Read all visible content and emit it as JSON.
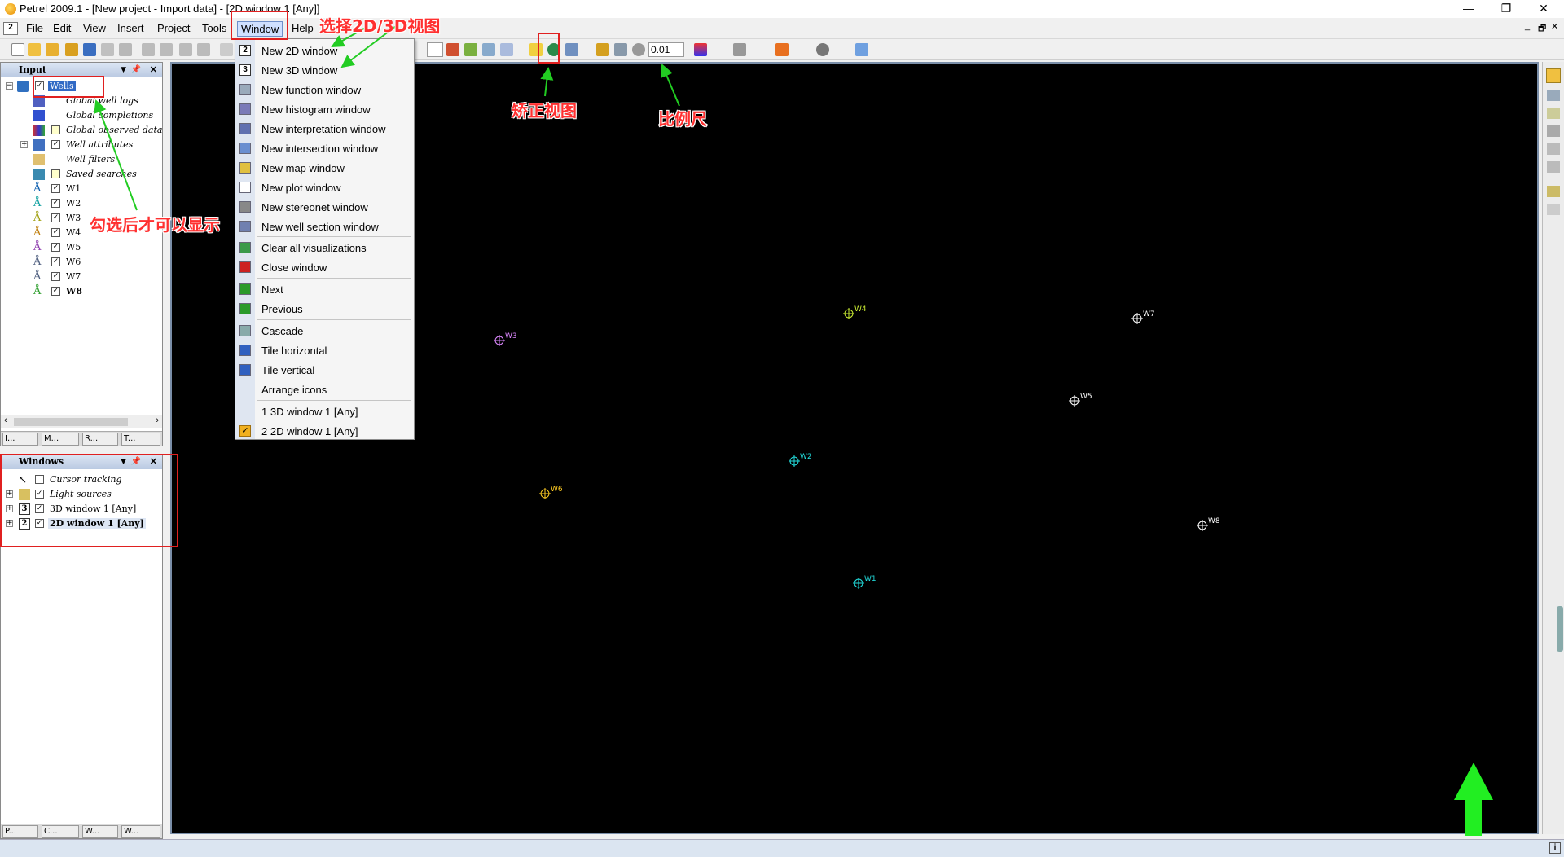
{
  "window": {
    "title": "Petrel 2009.1 - [New project - Import data] - [2D window 1 [Any]]",
    "minimize": "—",
    "restore": "❐",
    "close": "✕",
    "mdi_minimize": "_",
    "mdi_restore": "🗗",
    "mdi_close": "✕"
  },
  "menubar": {
    "doc_icon": "2",
    "items": [
      "File",
      "Edit",
      "View",
      "Insert",
      "Project",
      "Tools",
      "Window",
      "Help"
    ]
  },
  "toolbar": {
    "scale_value": "0.01"
  },
  "input_panel": {
    "title": "Input",
    "tree": [
      {
        "label": "Wells",
        "checked": true
      },
      {
        "label": "Global well logs"
      },
      {
        "label": "Global completions"
      },
      {
        "label": "Global observed data"
      },
      {
        "label": "Well attributes",
        "checked": true
      },
      {
        "label": "Well filters"
      },
      {
        "label": "Saved searches"
      },
      {
        "label": "W1",
        "checked": true
      },
      {
        "label": "W2",
        "checked": true
      },
      {
        "label": "W3",
        "checked": true
      },
      {
        "label": "W4",
        "checked": true
      },
      {
        "label": "W5",
        "checked": true
      },
      {
        "label": "W6",
        "checked": true
      },
      {
        "label": "W7",
        "checked": true
      },
      {
        "label": "W8",
        "checked": true
      }
    ],
    "tabs": [
      "I...",
      "M...",
      "R...",
      "T..."
    ]
  },
  "windows_panel": {
    "title": "Windows",
    "tree": [
      {
        "label": "Cursor tracking",
        "checked": false
      },
      {
        "label": "Light sources",
        "checked": true
      },
      {
        "label": "3D window 1 [Any]",
        "checked": true,
        "num": "3"
      },
      {
        "label": "2D window 1 [Any]",
        "checked": true,
        "num": "2"
      }
    ],
    "tabs": [
      "P...",
      "C...",
      "W...",
      "W..."
    ]
  },
  "window_menu": {
    "items": [
      {
        "label": "New 2D window",
        "icon": "2"
      },
      {
        "label": "New 3D window",
        "icon": "3"
      },
      {
        "label": "New function window"
      },
      {
        "label": "New histogram window"
      },
      {
        "label": "New interpretation window"
      },
      {
        "label": "New intersection window"
      },
      {
        "label": "New map window"
      },
      {
        "label": "New plot window"
      },
      {
        "label": "New stereonet window"
      },
      {
        "label": "New well section window"
      },
      {
        "label": "Clear all visualizations"
      },
      {
        "label": "Close window"
      },
      {
        "label": "Next"
      },
      {
        "label": "Previous"
      },
      {
        "label": "Cascade"
      },
      {
        "label": "Tile horizontal"
      },
      {
        "label": "Tile vertical"
      },
      {
        "label": "Arrange icons"
      },
      {
        "label": "1 3D window 1 [Any]"
      },
      {
        "label": "2 2D window 1 [Any]"
      }
    ]
  },
  "wells": [
    {
      "name": "W3",
      "color": "#dd88ff"
    },
    {
      "name": "W4",
      "color": "#ccee33"
    },
    {
      "name": "W7",
      "color": "#ffffff"
    },
    {
      "name": "W5",
      "color": "#ffffff"
    },
    {
      "name": "W2",
      "color": "#22dddd"
    },
    {
      "name": "W8",
      "color": "#ffffff"
    },
    {
      "name": "W6",
      "color": "#ffcc22"
    },
    {
      "name": "W1",
      "color": "#22dddd"
    }
  ],
  "annotations": {
    "select_view": "选择2D/3D视图",
    "correct_view": "矫正视图",
    "scale": "比例尺",
    "check_to_show": "勾选后才可以显示"
  },
  "colors": {
    "annotation": "#ff3030",
    "arrow": "#22cc22",
    "canvas": "#000000"
  }
}
